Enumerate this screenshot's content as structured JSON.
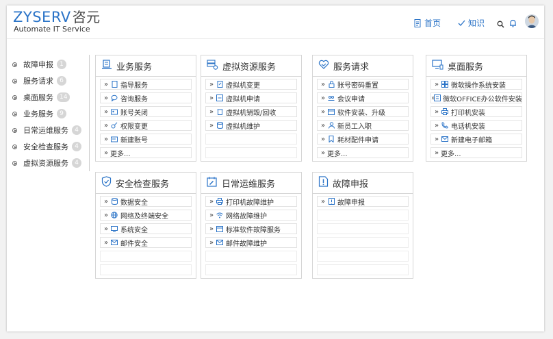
{
  "brand": {
    "name": "ZYSERV",
    "name_cn": "咨元",
    "tagline": "Automate IT Service"
  },
  "nav": {
    "home": "首页",
    "knowledge": "知识"
  },
  "header_icons": [
    "search-icon",
    "bell-icon",
    "avatar"
  ],
  "colors": {
    "accent": "#2a73c7",
    "badge": "#d6d6d6"
  },
  "sidebar": {
    "items": [
      {
        "label": "故障申报",
        "count": "1"
      },
      {
        "label": "服务请求",
        "count": "6"
      },
      {
        "label": "桌面服务",
        "count": "14"
      },
      {
        "label": "业务服务",
        "count": "9"
      },
      {
        "label": "日常运维服务",
        "count": "4"
      },
      {
        "label": "安全检查服务",
        "count": "4"
      },
      {
        "label": "虚拟资源服务",
        "count": "4"
      }
    ]
  },
  "cards": {
    "business": {
      "title": "业务服务",
      "items": [
        "指导服务",
        "咨询服务",
        "账号关闭",
        "权限变更",
        "新建账号",
        "更多..."
      ]
    },
    "virtual": {
      "title": "虚拟资源服务",
      "items": [
        "虚拟机变更",
        "虚拟机申请",
        "虚拟机销毁/回收",
        "虚拟机维护"
      ]
    },
    "request": {
      "title": "服务请求",
      "items": [
        "账号密码重置",
        "会议申请",
        "软件安装、升级",
        "新员工入职",
        "耗材配件申请",
        "更多..."
      ]
    },
    "desktop": {
      "title": "桌面服务",
      "items": [
        "微软操作系统安装",
        "微软OFFICE办公软件安装",
        "打印机安装",
        "电话机安装",
        "新建电子邮箱",
        "更多..."
      ]
    },
    "security": {
      "title": "安全检查服务",
      "items": [
        "数据安全",
        "网络及终端安全",
        "系统安全",
        "邮件安全"
      ]
    },
    "ops": {
      "title": "日常运维服务",
      "items": [
        "打印机故障维护",
        "网络故障维护",
        "标准软件故障服务",
        "邮件故障维护"
      ]
    },
    "fault": {
      "title": "故障申报",
      "items": [
        "故障申报"
      ]
    }
  }
}
